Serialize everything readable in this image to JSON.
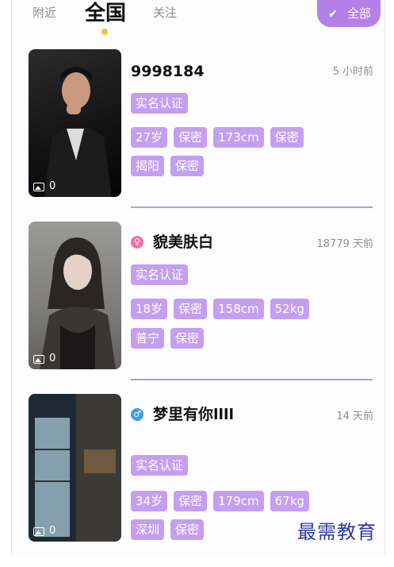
{
  "tabs": {
    "near": "附近",
    "all": "全国",
    "follow": "关注",
    "filter": "全部"
  },
  "users": [
    {
      "name": "9998184",
      "time": "5 小时前",
      "photo_count": "0",
      "tags1": [
        "实名认证"
      ],
      "tags2": [
        "27岁",
        "保密",
        "173cm",
        "保密"
      ],
      "tags3": [
        "揭阳",
        "保密"
      ]
    },
    {
      "name": "貌美肤白",
      "gender": "female",
      "gender_symbol": "♀",
      "time": "18779 天前",
      "photo_count": "0",
      "tags1": [
        "实名认证"
      ],
      "tags2": [
        "18岁",
        "保密",
        "158cm",
        "52kg"
      ],
      "tags3": [
        "普宁",
        "保密"
      ]
    },
    {
      "name": "梦里有你llll",
      "gender": "male",
      "gender_symbol": "♂",
      "time": "14 天前",
      "photo_count": "0",
      "tags1": [
        "实名认证"
      ],
      "tags2": [
        "34岁",
        "保密",
        "179cm",
        "67kg"
      ],
      "tags3": [
        "深圳",
        "保密"
      ]
    }
  ],
  "colors": {
    "accent": "#b480e6",
    "tag": "#c49ff0",
    "female": "#ef6fa6",
    "male": "#3b9be8"
  },
  "watermark": "最需教育"
}
